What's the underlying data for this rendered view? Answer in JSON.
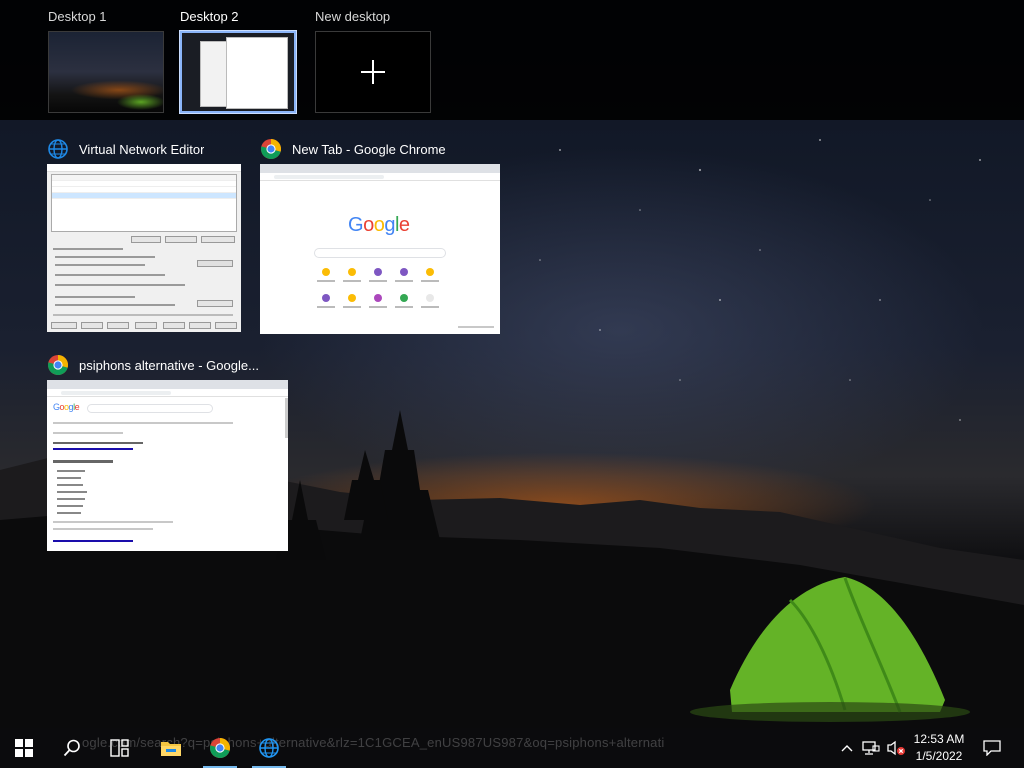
{
  "desktops": [
    {
      "label": "Desktop 1",
      "active": false
    },
    {
      "label": "Desktop 2",
      "active": true
    },
    {
      "label": "New desktop",
      "active": false
    }
  ],
  "windows": [
    {
      "title": "Virtual Network Editor",
      "icon": "globe-icon"
    },
    {
      "title": "New Tab - Google Chrome",
      "icon": "chrome-icon"
    },
    {
      "title": "psiphons alternative - Google...",
      "icon": "chrome-icon"
    }
  ],
  "thumb_text": {
    "google_logo": "Google"
  },
  "taskbar": {
    "ghost_text": "ogle.com/search?q=psiphons+alternative&rlz=1C1GCEA_enUS987US987&oq=psiphons+alternati",
    "apps": [
      "start-icon",
      "search-icon",
      "task-view-icon",
      "file-explorer-icon",
      "chrome-icon",
      "globe-icon"
    ]
  },
  "tray": {
    "time": "12:53 AM",
    "date": "1/5/2022",
    "icons": [
      "chevron-up-icon",
      "network-icon",
      "volume-muted-icon",
      "notifications-icon"
    ]
  },
  "colors": {
    "accent": "#76b9ed",
    "active_border": "#8ab4f8",
    "taskbar": "#0c0c0e"
  }
}
